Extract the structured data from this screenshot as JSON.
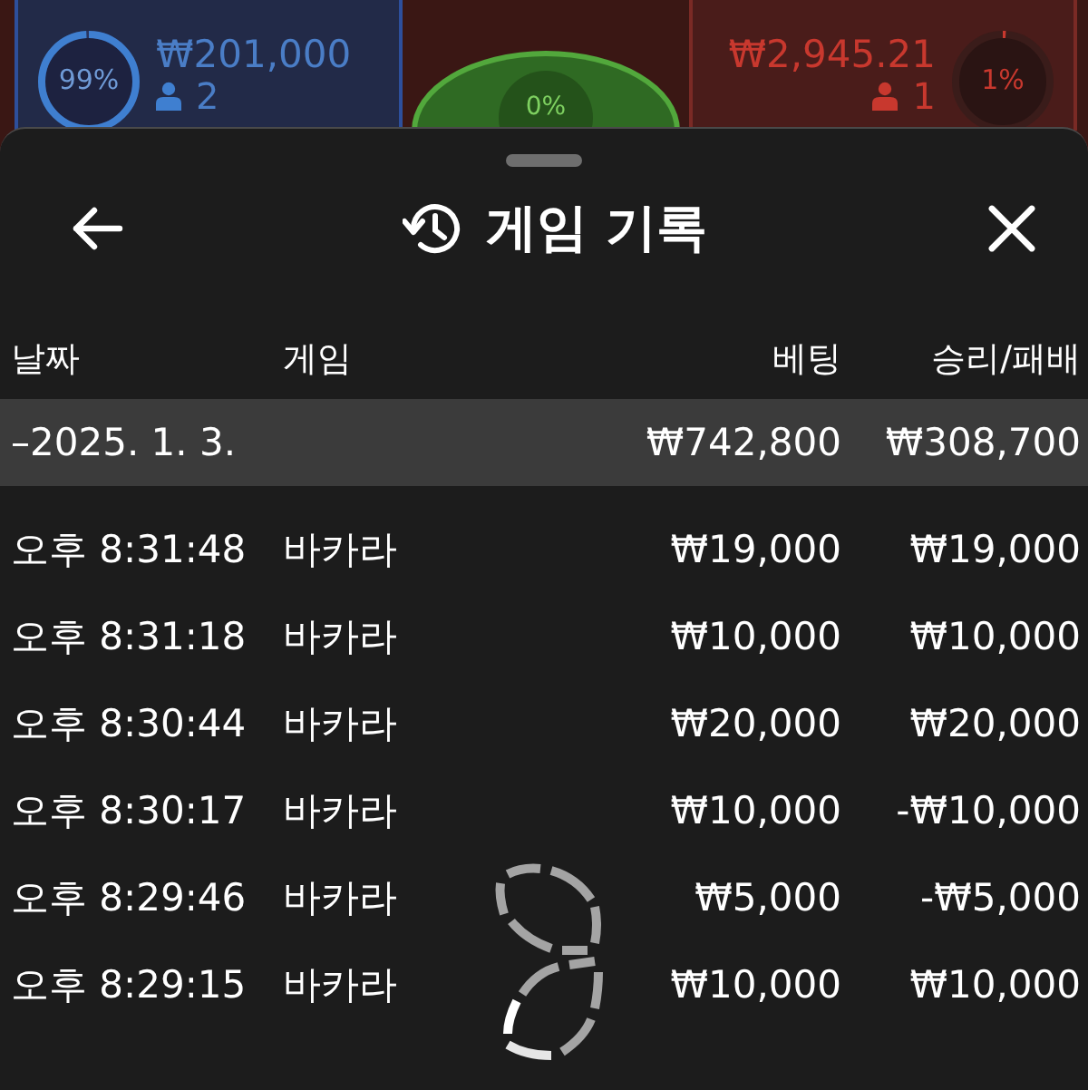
{
  "bet_panels": [
    {
      "kind": "player",
      "percent": "99%",
      "amount": "₩201,000",
      "players": "2"
    },
    {
      "kind": "tie",
      "percent": "0%"
    },
    {
      "kind": "banker",
      "percent": "1%",
      "amount": "₩2,945.21",
      "players": "1"
    }
  ],
  "sheet": {
    "title": "게임 기록",
    "table": {
      "columns": [
        "날짜",
        "게임",
        "베팅",
        "승리/패배"
      ],
      "summary": {
        "date": "–2025. 1. 3.",
        "bet": "₩742,800",
        "result": "₩308,700"
      },
      "rows": [
        {
          "time": "오후 8:31:48",
          "game": "바카라",
          "bet": "₩19,000",
          "result": "₩19,000"
        },
        {
          "time": "오후 8:31:18",
          "game": "바카라",
          "bet": "₩10,000",
          "result": "₩10,000"
        },
        {
          "time": "오후 8:30:44",
          "game": "바카라",
          "bet": "₩20,000",
          "result": "₩20,000"
        },
        {
          "time": "오후 8:30:17",
          "game": "바카라",
          "bet": "₩10,000",
          "result": "-₩10,000"
        },
        {
          "time": "오후 8:29:46",
          "game": "바카라",
          "bet": "₩5,000",
          "result": "-₩5,000"
        },
        {
          "time": "오후 8:29:15",
          "game": "바카라",
          "bet": "₩10,000",
          "result": "₩10,000"
        }
      ]
    }
  },
  "loading": true
}
